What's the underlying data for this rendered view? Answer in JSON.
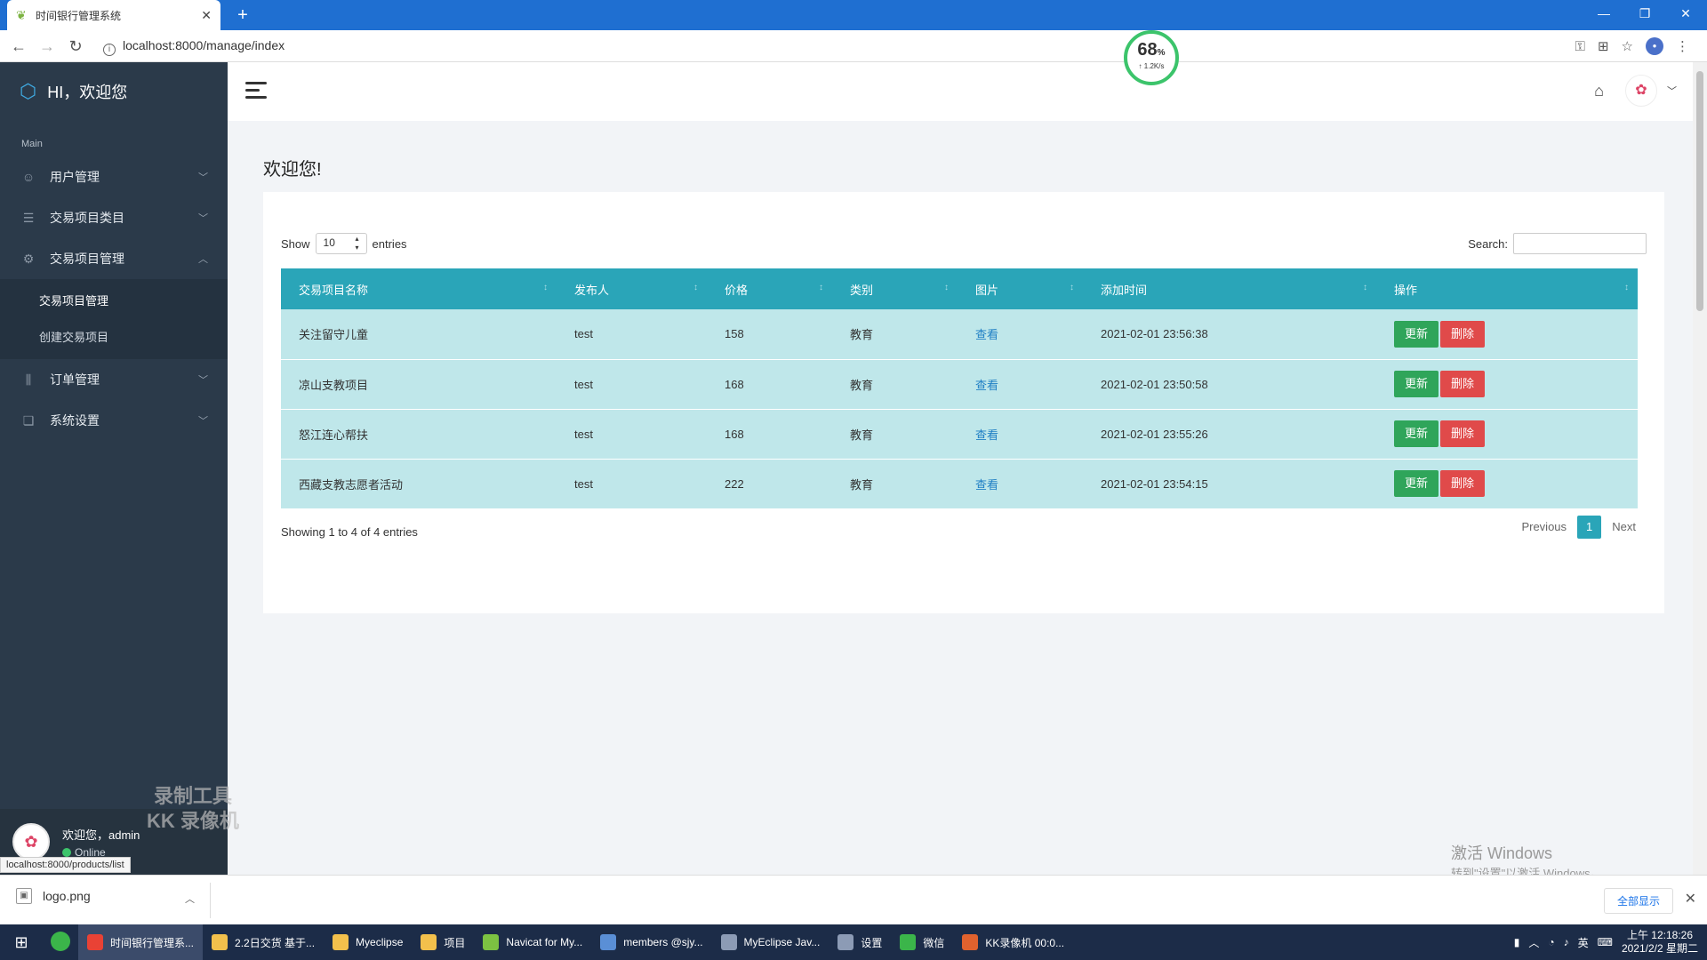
{
  "browser": {
    "tab_title": "时间银行管理系统",
    "url": "localhost:8000/manage/index",
    "new_tab": "+",
    "status_url": "localhost:8000/products/list"
  },
  "meter": {
    "percent": "68",
    "percent_sign": "%",
    "speed": "↑ 1.2K/s"
  },
  "sidebar": {
    "brand": "HI，欢迎您",
    "section_label": "Main",
    "items": [
      {
        "label": "用户管理",
        "icon": "users-icon"
      },
      {
        "label": "交易项目类目",
        "icon": "list-icon"
      },
      {
        "label": "交易项目管理",
        "icon": "gear-icon"
      },
      {
        "label": "订单管理",
        "icon": "sliders-icon"
      },
      {
        "label": "系统设置",
        "icon": "copy-icon"
      }
    ],
    "submenu": [
      "交易项目管理",
      "创建交易项目"
    ],
    "user": {
      "greeting": "欢迎您，admin",
      "status": "Online"
    }
  },
  "watermark": {
    "line1": "录制工具",
    "line2": "KK 录像机"
  },
  "page": {
    "title": "欢迎您!"
  },
  "table": {
    "show_label": "Show",
    "entries_label": "entries",
    "page_size": "10",
    "search_label": "Search:",
    "columns": [
      "交易项目名称",
      "发布人",
      "价格",
      "类别",
      "图片",
      "添加时间",
      "操作"
    ],
    "rows": [
      {
        "name": "关注留守儿童",
        "publisher": "test",
        "price": "158",
        "category": "教育",
        "image": "查看",
        "time": "2021-02-01 23:56:38"
      },
      {
        "name": "凉山支教项目",
        "publisher": "test",
        "price": "168",
        "category": "教育",
        "image": "查看",
        "time": "2021-02-01 23:50:58"
      },
      {
        "name": "怒江连心帮扶",
        "publisher": "test",
        "price": "168",
        "category": "教育",
        "image": "查看",
        "time": "2021-02-01 23:55:26"
      },
      {
        "name": "西藏支教志愿者活动",
        "publisher": "test",
        "price": "222",
        "category": "教育",
        "image": "查看",
        "time": "2021-02-01 23:54:15"
      }
    ],
    "update_label": "更新",
    "delete_label": "删除",
    "info": "Showing 1 to 4 of 4 entries",
    "pager": {
      "previous": "Previous",
      "current": "1",
      "next": "Next"
    }
  },
  "windows_activate": {
    "title": "激活 Windows",
    "subtitle": "转到\"设置\"以激活 Windows。"
  },
  "downloads": {
    "file": "logo.png",
    "show_all": "全部显示"
  },
  "taskbar": {
    "apps": [
      {
        "label": "时间银行管理系...",
        "color": "#e94235"
      },
      {
        "label": "2.2日交货 基于...",
        "color": "#f2c04c"
      },
      {
        "label": "Myeclipse",
        "color": "#f2c04c"
      },
      {
        "label": "项目",
        "color": "#f2c04c"
      },
      {
        "label": "Navicat for My...",
        "color": "#7cc242"
      },
      {
        "label": "members @sjy...",
        "color": "#5a8fd6"
      },
      {
        "label": "MyEclipse Jav...",
        "color": "#8c9bb5"
      },
      {
        "label": "设置",
        "color": "#8c9bb5"
      },
      {
        "label": "微信",
        "color": "#3bb54a"
      },
      {
        "label": "KK录像机 00:0...",
        "color": "#e0622e"
      }
    ],
    "ime": "英",
    "time": "上午 12:18:26",
    "date": "2021/2/2 星期二"
  }
}
